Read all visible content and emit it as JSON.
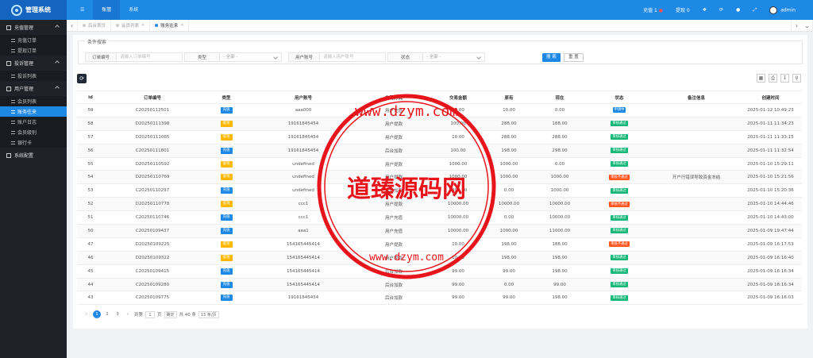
{
  "header": {
    "app_title": "管理系统",
    "nav": [
      "☰",
      "账管",
      "系统"
    ],
    "recharge_label": "充值 1",
    "withdraw_label": "提现 0",
    "user": "admin"
  },
  "sidebar": {
    "groups": [
      {
        "label": "充值管理",
        "items": [
          "充值订单",
          "提现订单"
        ]
      },
      {
        "label": "投诉管理",
        "items": [
          "投诉列表"
        ]
      },
      {
        "label": "用户管理",
        "items": [
          "会员列表",
          "账务往来",
          "账户日志",
          "会员级别",
          "银行卡"
        ]
      },
      {
        "label": "系统配置",
        "items": []
      }
    ],
    "active_item": "账务往来"
  },
  "tabs": [
    {
      "label": "后台首页",
      "closable": false
    },
    {
      "label": "会员列表",
      "closable": true
    },
    {
      "label": "账务往来",
      "closable": true,
      "active": true
    }
  ],
  "filter": {
    "legend": "条件搜索",
    "order_label": "订单编号",
    "order_placeholder": "请输入订单编号",
    "type_label": "类型",
    "type_value": "- 全部 -",
    "account_label": "用户账号",
    "account_placeholder": "请输入用户账号",
    "status_label": "状态",
    "status_value": "- 全部 -",
    "search_btn": "搜 索",
    "reset_btn": "重 置"
  },
  "table": {
    "columns": [
      "id",
      "订单编号",
      "类型",
      "用户账号",
      "交易方式",
      "交易金额",
      "原有",
      "现在",
      "状态",
      "备注信息",
      "创建时间"
    ],
    "rows": [
      [
        "59",
        "C20250112501",
        "充值",
        "aaa000",
        "用户充值",
        "10.00",
        "10.00",
        "0.00",
        "申请中",
        "",
        "2025-01-12 10:49:23"
      ],
      [
        "58",
        "D20250111398",
        "提现",
        "19161845454",
        "用户提款",
        "100.00",
        "288.00",
        "188.00",
        "审核通过",
        "",
        "2025-01-11 11:34:23"
      ],
      [
        "57",
        "D20250111065",
        "提现",
        "19161845454",
        "用户提款",
        "10.00",
        "288.00",
        "288.00",
        "审核通过",
        "",
        "2025-01-11 11:33:15"
      ],
      [
        "56",
        "C20250111801",
        "充值",
        "19161845454",
        "后台加款",
        "100.00",
        "198.00",
        "298.00",
        "审核通过",
        "",
        "2025-01-11 11:32:54"
      ],
      [
        "55",
        "D20250110592",
        "提现",
        "undefined",
        "用户提款",
        "1000.00",
        "1000.00",
        "0.00",
        "审核通过",
        "",
        "2025-01-10 15:29:11"
      ],
      [
        "54",
        "D20250110769",
        "提现",
        "undefined",
        "用户提款",
        "1000.00",
        "1000.00",
        "1000.00",
        "审核不通过",
        "开户行错误导致资金冻结",
        "2025-01-10 15:21:56"
      ],
      [
        "53",
        "C20250110297",
        "充值",
        "undefined",
        "后台加款",
        "1000.00",
        "0.00",
        "1000.00",
        "审核通过",
        "",
        "2025-01-10 15:20:36"
      ],
      [
        "52",
        "D20250110778",
        "提现",
        "ccc1",
        "用户提款",
        "10000.00",
        "10000.00",
        "10000.00",
        "审核不通过",
        "",
        "2025-01-10 14:44:46"
      ],
      [
        "51",
        "C20250110746",
        "充值",
        "ccc1",
        "用户充值",
        "10000.00",
        "0.00",
        "10000.00",
        "审核通过",
        "",
        "2025-01-10 14:43:00"
      ],
      [
        "50",
        "C20250109437",
        "充值",
        "aaa1",
        "用户充值",
        "10000.00",
        "1000.00",
        "11000.00",
        "审核通过",
        "",
        "2025-01-09 19:47:44"
      ],
      [
        "47",
        "D20250109225",
        "提现",
        "154165445414",
        "用户提款",
        "10.00",
        "198.00",
        "188.00",
        "审核不通过",
        "",
        "2025-01-09 16:17:53"
      ],
      [
        "46",
        "D20250109322",
        "提现",
        "154165445414",
        "用户提款",
        "10.00",
        "198.00",
        "198.00",
        "审核通过",
        "",
        "2025-01-09 16:16:40"
      ],
      [
        "45",
        "C20250109415",
        "充值",
        "154165445414",
        "后台加款",
        "99.00",
        "99.00",
        "198.00",
        "审核通过",
        "",
        "2025-01-09 16:16:34"
      ],
      [
        "44",
        "C20250109280",
        "充值",
        "154165445414",
        "后台加款",
        "99.00",
        "0.00",
        "99.00",
        "审核通过",
        "",
        "2025-01-09 16:16:34"
      ],
      [
        "43",
        "C20250109775",
        "充值",
        "19161845454",
        "后台加款",
        "99.00",
        "99.00",
        "198.00",
        "审核通过",
        "",
        "2025-01-09 16:16:03"
      ]
    ]
  },
  "pager": {
    "prev": "‹",
    "pages": [
      "1",
      "2",
      "3"
    ],
    "next": "›",
    "goto_label": "到第",
    "goto_value": "1",
    "page_unit": "页",
    "confirm": "确定",
    "total": "共 40 条",
    "page_size": "15 条/页"
  },
  "watermark": {
    "text": "道臻源码网",
    "url": "www.dzym.com"
  },
  "colors": {
    "primary": "#1e88e5",
    "sidebar": "#20222a",
    "success": "#16b777",
    "danger": "#ff5722",
    "warning": "#ffb800",
    "watermark": "#e8141b"
  }
}
